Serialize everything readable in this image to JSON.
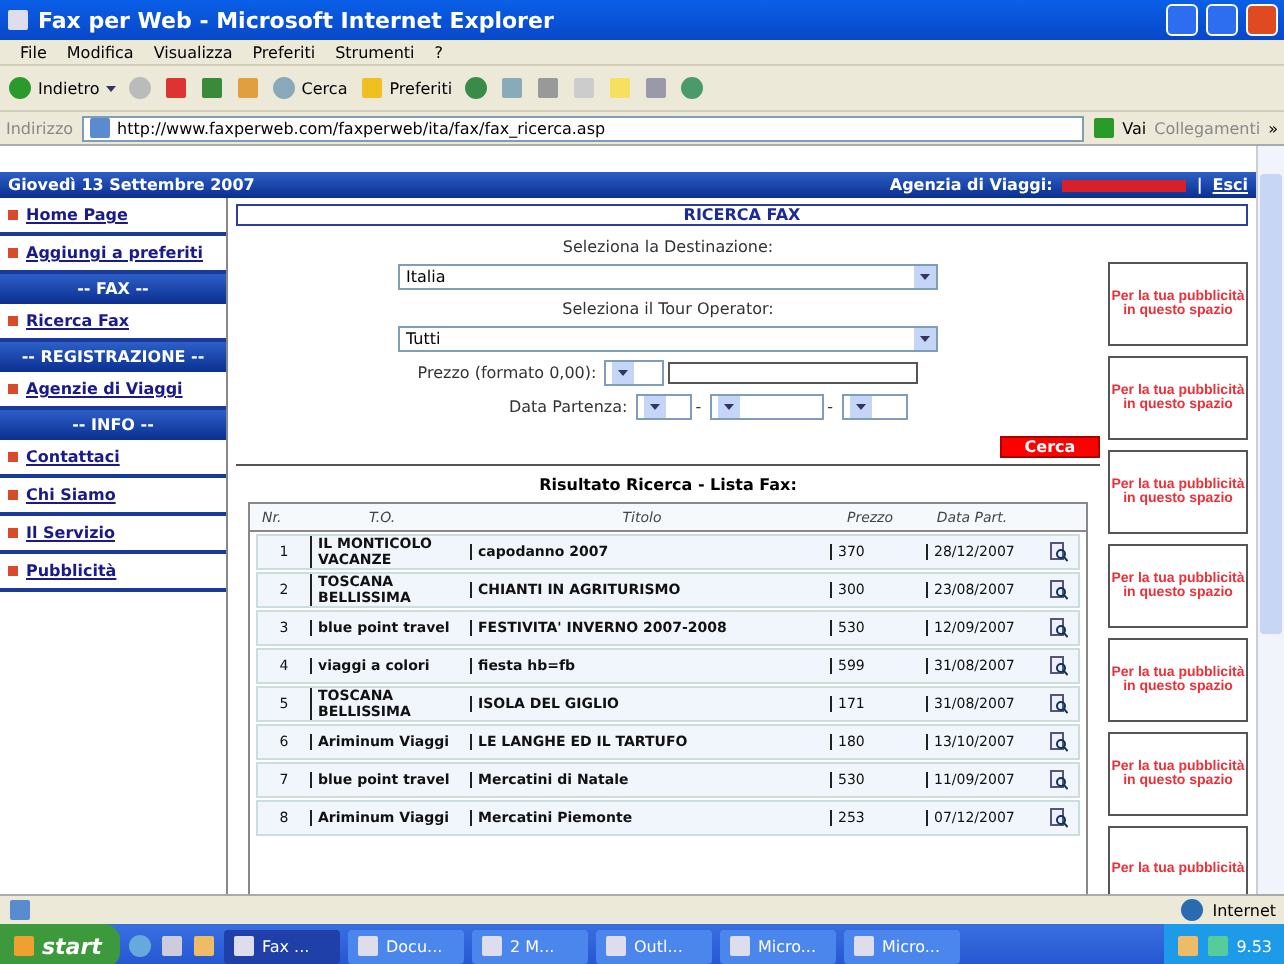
{
  "window": {
    "title": "Fax per Web - Microsoft Internet Explorer"
  },
  "menu": [
    "File",
    "Modifica",
    "Visualizza",
    "Preferiti",
    "Strumenti",
    "?"
  ],
  "toolbar": {
    "back": "Indietro",
    "search": "Cerca",
    "favorites": "Preferiti"
  },
  "address": {
    "label": "Indirizzo",
    "url": "http://www.faxperweb.com/faxperweb/ita/fax/fax_ricerca.asp",
    "go": "Vai",
    "links": "Collegamenti",
    "more": "»"
  },
  "header": {
    "date": "Giovedì 13 Settembre 2007",
    "agency_label": "Agenzia di Viaggi:",
    "separator": "|",
    "logout": "Esci"
  },
  "sidebar": [
    {
      "kind": "link",
      "label": "Home Page"
    },
    {
      "kind": "link",
      "label": "Aggiungi a preferiti"
    },
    {
      "kind": "section",
      "label": "-- FAX --"
    },
    {
      "kind": "link",
      "label": "Ricerca Fax"
    },
    {
      "kind": "section",
      "label": "-- REGISTRAZIONE --"
    },
    {
      "kind": "link",
      "label": "Agenzie di Viaggi"
    },
    {
      "kind": "section",
      "label": "-- INFO --"
    },
    {
      "kind": "link",
      "label": "Contattaci"
    },
    {
      "kind": "link",
      "label": "Chi Siamo"
    },
    {
      "kind": "link",
      "label": "Il Servizio"
    },
    {
      "kind": "link",
      "label": "Pubblicità"
    }
  ],
  "form": {
    "title": "RICERCA FAX",
    "destination_label": "Seleziona la Destinazione:",
    "destination": "Italia",
    "operator_label": "Seleziona il Tour Operator:",
    "operator": "Tutti",
    "price_label": "Prezzo (formato 0,00):",
    "date_label": "Data Partenza:",
    "date_separator": "-",
    "submit": "Cerca"
  },
  "results": {
    "title": "Risultato Ricerca - Lista Fax:",
    "columns": [
      "Nr.",
      "T.O.",
      "Titolo",
      "Prezzo",
      "Data Part."
    ],
    "rows": [
      [
        "1",
        "IL MONTICOLO VACANZE",
        "capodanno 2007",
        "370",
        "28/12/2007"
      ],
      [
        "2",
        "TOSCANA BELLISSIMA",
        "CHIANTI IN AGRITURISMO",
        "300",
        "23/08/2007"
      ],
      [
        "3",
        "blue point travel",
        "FESTIVITA' INVERNO 2007-2008",
        "530",
        "12/09/2007"
      ],
      [
        "4",
        "viaggi a colori",
        "fiesta hb=fb",
        "599",
        "31/08/2007"
      ],
      [
        "5",
        "TOSCANA BELLISSIMA",
        "ISOLA DEL GIGLIO",
        "171",
        "31/08/2007"
      ],
      [
        "6",
        "Ariminum Viaggi",
        "LE LANGHE ED IL TARTUFO",
        "180",
        "13/10/2007"
      ],
      [
        "7",
        "blue point travel",
        "Mercatini di Natale",
        "530",
        "11/09/2007"
      ],
      [
        "8",
        "Ariminum Viaggi",
        "Mercatini Piemonte",
        "253",
        "07/12/2007"
      ]
    ]
  },
  "ads": [
    "Per la tua pubblicità in questo spazio",
    "Per la tua pubblicità in questo spazio",
    "Per la tua pubblicità in questo spazio",
    "Per la tua pubblicità in questo spazio",
    "Per la tua pubblicità in questo spazio",
    "Per la tua pubblicità in questo spazio",
    "Per la tua pubblicità"
  ],
  "status": {
    "zone": "Internet"
  },
  "taskbar": {
    "start": "start",
    "tasks": [
      {
        "label": "Fax ...",
        "selected": true
      },
      {
        "label": "Docu...",
        "selected": false
      },
      {
        "label": "2 M...",
        "selected": false
      },
      {
        "label": "Outl...",
        "selected": false
      },
      {
        "label": "Micro...",
        "selected": false
      },
      {
        "label": "Micro...",
        "selected": false
      }
    ],
    "clock": "9.53"
  }
}
